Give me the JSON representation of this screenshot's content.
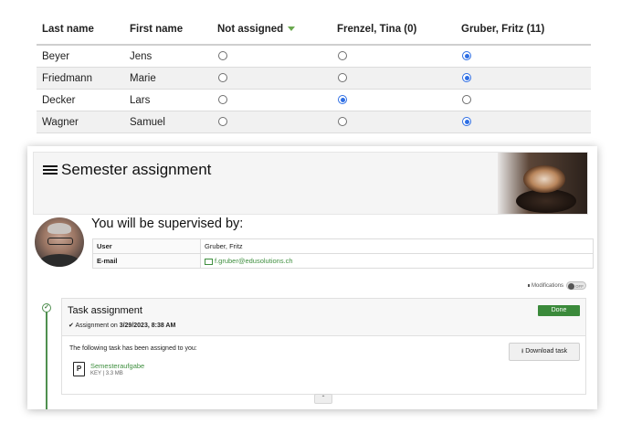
{
  "table": {
    "headers": [
      "Last name",
      "First name",
      "Not assigned",
      "Frenzel, Tina (0)",
      "Gruber, Fritz (11)"
    ],
    "rows": [
      {
        "last": "Beyer",
        "first": "Jens",
        "selected": 2
      },
      {
        "last": "Friedmann",
        "first": "Marie",
        "selected": 2
      },
      {
        "last": "Decker",
        "first": "Lars",
        "selected": 1
      },
      {
        "last": "Wagner",
        "first": "Samuel",
        "selected": 2
      }
    ]
  },
  "card": {
    "title": "Semester assignment",
    "header_icon": "list-icon",
    "supervisor_heading": "You will be supervised by:",
    "user_label": "User",
    "user_value": "Gruber, Fritz",
    "email_label": "E-mail",
    "email_value": "f.gruber@edusolutions.ch",
    "modifications_label": "Modifications",
    "toggle_state": "OFF",
    "task": {
      "title": "Task assignment",
      "status": "Done",
      "assigned_prefix": "Assignment on",
      "assigned_date": "3/29/2023, 8:38 AM",
      "body_text": "The following task has been assigned to you:",
      "download_label": "Download task",
      "file_name": "Semesteraufgabe",
      "file_meta": "KEY | 3.3 MB"
    }
  },
  "colors": {
    "accent_green": "#3b8a3b",
    "radio_blue": "#2f6fe4"
  }
}
